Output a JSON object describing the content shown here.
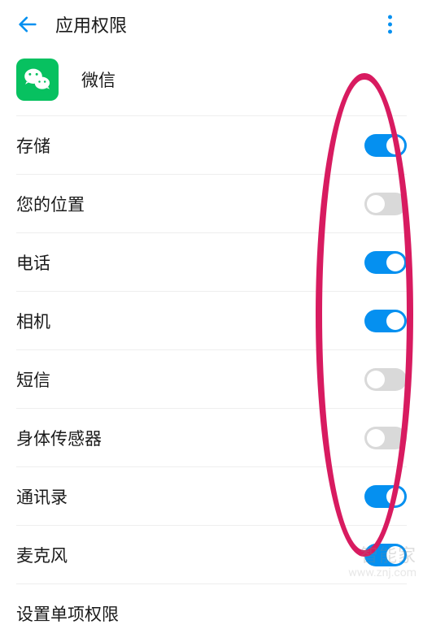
{
  "header": {
    "title": "应用权限"
  },
  "app": {
    "name": "微信"
  },
  "permissions": [
    {
      "label": "存储",
      "enabled": true
    },
    {
      "label": "您的位置",
      "enabled": false
    },
    {
      "label": "电话",
      "enabled": true
    },
    {
      "label": "相机",
      "enabled": true
    },
    {
      "label": "短信",
      "enabled": false
    },
    {
      "label": "身体传感器",
      "enabled": false
    },
    {
      "label": "通讯录",
      "enabled": true
    },
    {
      "label": "麦克风",
      "enabled": true
    }
  ],
  "footer_item": {
    "label": "设置单项权限"
  },
  "watermark": {
    "main": "智能家",
    "sub": "www.znj.com"
  }
}
